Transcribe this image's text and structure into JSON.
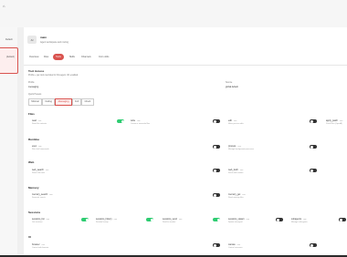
{
  "window": {
    "app_glyph": "⌂"
  },
  "left_pane": {
    "item_1": "Default",
    "item_2": "(default)"
  },
  "agent": {
    "icon": "AI",
    "name": "main",
    "desc": "Agent workspace and routing"
  },
  "tabs": [
    "Overview",
    "Files",
    "Tools",
    "Skills",
    "Channels",
    "Cron Jobs"
  ],
  "active_tab": "Tools",
  "tool_access": {
    "title": "Tool Access",
    "subtitle": "Profile + per-tool overrides for this agent. 0/1 enabled.",
    "profile_label": "Profile",
    "profile_value": "messaging",
    "source_label": "Source",
    "source_value": "global default",
    "quick_presets_label": "Quick Presets",
    "presets": [
      "Minimal",
      "Coding",
      "Messaging",
      "Full",
      "Inherit"
    ],
    "active_preset": "Messaging"
  },
  "sections": [
    {
      "title": "Files",
      "items": [
        {
          "name": "read",
          "tag": "core",
          "desc": "Read file contents",
          "on": true
        },
        {
          "name": "write",
          "tag": "core",
          "desc": "Create or overwrite files",
          "on": false
        },
        {
          "name": "edit",
          "tag": "core",
          "desc": "Make precise edits",
          "on": false
        },
        {
          "name": "apply_patch",
          "tag": "core",
          "desc": "Patch files (OpenAI)",
          "on": false
        }
      ]
    },
    {
      "title": "Runtime",
      "items": [
        {
          "name": "exec",
          "tag": "core",
          "desc": "Run shell commands",
          "on": false
        },
        {
          "name": "process",
          "tag": "core",
          "desc": "Manage background processes",
          "on": false
        }
      ]
    },
    {
      "title": "Web",
      "items": [
        {
          "name": "web_search",
          "tag": "core",
          "desc": "Search the web",
          "on": false
        },
        {
          "name": "web_fetch",
          "tag": "core",
          "desc": "Fetch web content",
          "on": false
        }
      ]
    },
    {
      "title": "Memory",
      "items": [
        {
          "name": "memory_search",
          "tag": "core",
          "desc": "Semantic search",
          "on": false
        },
        {
          "name": "memory_get",
          "tag": "core",
          "desc": "Read memory files",
          "on": false
        }
      ]
    },
    {
      "title": "Sessions",
      "items": [
        {
          "name": "sessions_list",
          "tag": "core",
          "desc": "List sessions",
          "on": true
        },
        {
          "name": "sessions_history",
          "tag": "core",
          "desc": "Session history",
          "on": true
        },
        {
          "name": "sessions_send",
          "tag": "core",
          "desc": "Send to session",
          "on": true
        },
        {
          "name": "sessions_spawn",
          "tag": "core",
          "desc": "Spawn sub-agent",
          "on": false
        },
        {
          "name": "subagents",
          "tag": "core",
          "desc": "Manage sub-agents",
          "on": false
        }
      ]
    },
    {
      "title": "UI",
      "items": [
        {
          "name": "browser",
          "tag": "core",
          "desc": "Control web browser",
          "on": false
        },
        {
          "name": "canvas",
          "tag": "core",
          "desc": "Control canvases",
          "on": false
        }
      ]
    }
  ]
}
